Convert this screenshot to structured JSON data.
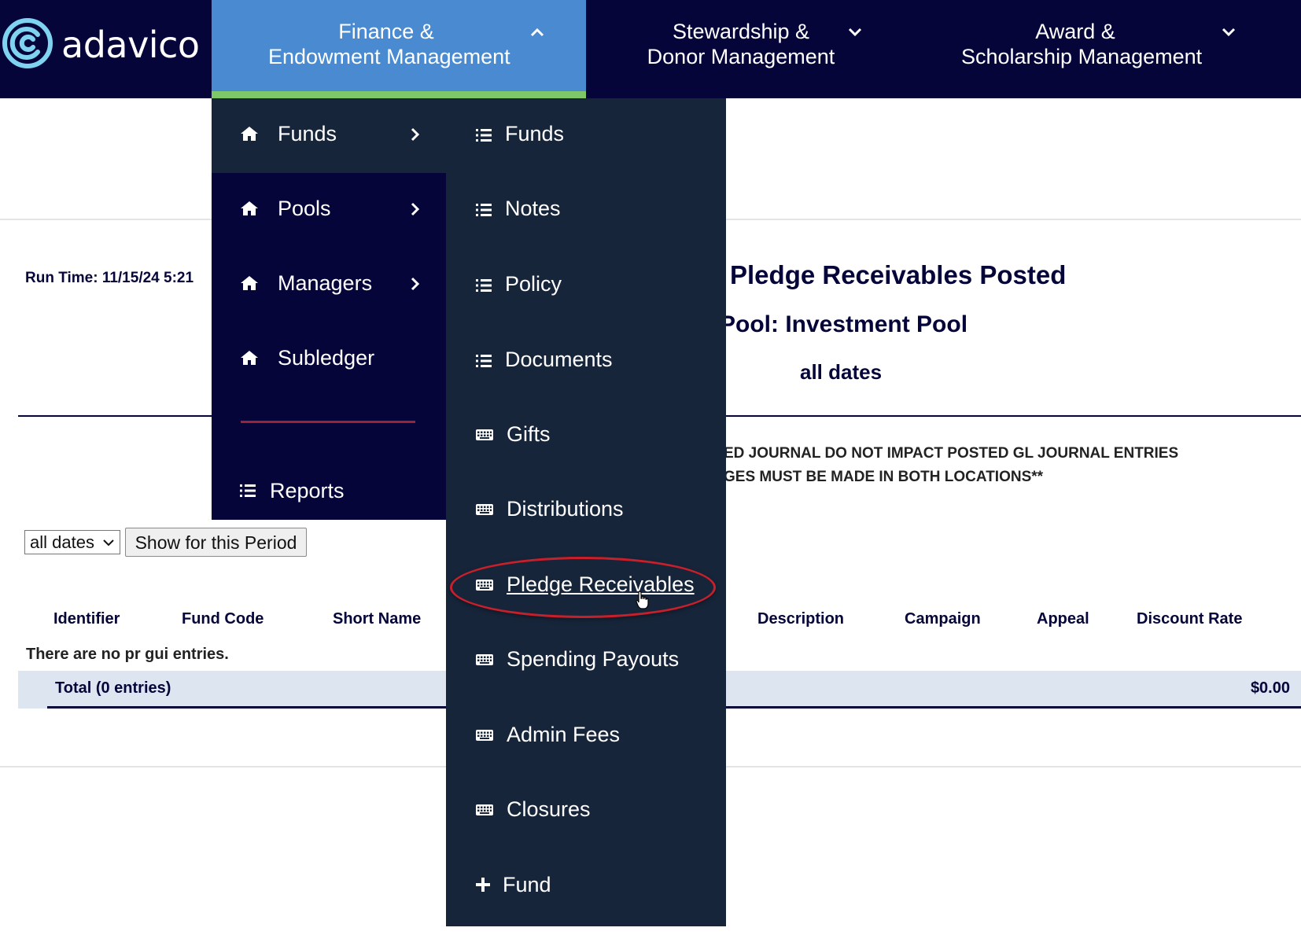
{
  "brand": {
    "name": "adavico"
  },
  "nav": {
    "items": [
      {
        "label_line1": "Finance &",
        "label_line2": "Endowment Management",
        "active": true
      },
      {
        "label_line1": "Stewardship &",
        "label_line2": "Donor Management",
        "active": false
      },
      {
        "label_line1": "Award &",
        "label_line2": "Scholarship Management",
        "active": false
      }
    ]
  },
  "menu_level1": {
    "items": [
      {
        "label": "Funds",
        "icon": "home-icon",
        "has_submenu": true,
        "active": true
      },
      {
        "label": "Pools",
        "icon": "home-icon",
        "has_submenu": true
      },
      {
        "label": "Managers",
        "icon": "home-icon",
        "has_submenu": true
      },
      {
        "label": "Subledger",
        "icon": "home-icon",
        "has_submenu": false
      }
    ],
    "reports": {
      "label": "Reports",
      "icon": "list-icon"
    }
  },
  "menu_level2": {
    "items": [
      {
        "label": "Funds",
        "icon": "list-icon"
      },
      {
        "label": "Notes",
        "icon": "list-icon"
      },
      {
        "label": "Policy",
        "icon": "list-icon"
      },
      {
        "label": "Documents",
        "icon": "list-icon"
      },
      {
        "label": "Gifts",
        "icon": "keyboard-icon"
      },
      {
        "label": "Distributions",
        "icon": "keyboard-icon"
      },
      {
        "label": "Pledge Receivables",
        "icon": "keyboard-icon",
        "hovered": true
      },
      {
        "label": "Spending Payouts",
        "icon": "keyboard-icon"
      },
      {
        "label": "Admin Fees",
        "icon": "keyboard-icon"
      },
      {
        "label": "Closures",
        "icon": "keyboard-icon"
      },
      {
        "label": "Fund",
        "icon": "plus-icon"
      }
    ]
  },
  "report": {
    "run_time": "Run Time: 11/15/24 5:21",
    "title": "Pledge Receivables Posted",
    "subtitle": "Pool: Investment Pool",
    "dates": "all dates",
    "warning_line1": "ED JOURNAL DO NOT IMPACT POSTED GL JOURNAL ENTRIES",
    "warning_line2": "GES MUST BE MADE IN BOTH LOCATIONS**"
  },
  "controls": {
    "period_select_value": "all dates",
    "show_button": "Show for this Period"
  },
  "table": {
    "headers": [
      "Identifier",
      "Fund Code",
      "Short Name",
      "Description",
      "Campaign",
      "Appeal",
      "Discount Rate"
    ],
    "empty_message": "There are no pr gui entries.",
    "total_label": "Total (0 entries)",
    "total_amount": "$0.00"
  },
  "colors": {
    "nav_bg": "#05053a",
    "nav_active": "#4a8ad0",
    "active_underline": "#7ec86a",
    "submenu_bg": "#17253a",
    "separator": "#9b2335",
    "highlight_ring": "#c8202a"
  }
}
